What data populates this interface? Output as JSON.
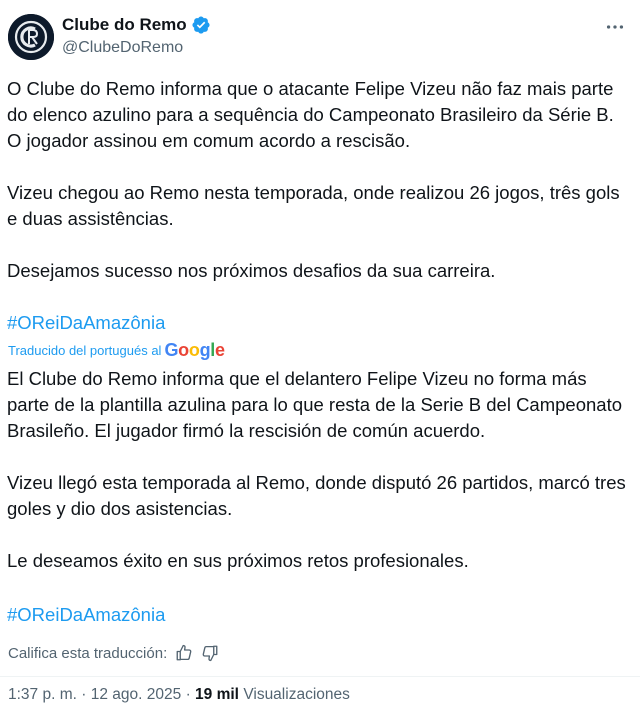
{
  "header": {
    "display_name": "Clube do Remo",
    "handle": "@ClubeDoRemo",
    "verified_icon": "verified-badge-icon",
    "more_icon": "more-options-icon"
  },
  "original": {
    "paragraph1": "O Clube do Remo informa que o atacante Felipe Vizeu não faz mais parte do elenco azulino para a sequência do Campeonato Brasileiro da Série B. O jogador assinou em comum acordo a rescisão.",
    "paragraph2": "Vizeu chegou ao Remo nesta temporada, onde realizou 26 jogos, três gols e duas assistências.",
    "paragraph3": "Desejamos sucesso nos próximos desafios da sua carreira.",
    "hashtag": "#OReiDaAmazônia"
  },
  "translation_note": {
    "label": "Traducido del portugués al",
    "brand": "Google"
  },
  "translated": {
    "paragraph1": "El Clube do Remo informa que el delantero Felipe Vizeu no forma más parte de la plantilla azulina para lo que resta de la Serie B del Campeonato Brasileño. El jugador firmó la rescisión de común acuerdo.",
    "paragraph2": "Vizeu llegó esta temporada al Remo, donde disputó 26 partidos, marcó tres goles y dio dos asistencias.",
    "paragraph3": "Le deseamos éxito en sus próximos retos profesionales.",
    "hashtag": "#OReiDaAmazônia"
  },
  "rating": {
    "label": "Califica esta traducción:",
    "like_icon": "thumbs-up-icon",
    "dislike_icon": "thumbs-down-icon"
  },
  "meta": {
    "time": "1:37 p. m.",
    "separator": "·",
    "date": "12 ago. 2025",
    "views_count": "19 mil",
    "views_label": "Visualizaciones"
  },
  "colors": {
    "accent": "#1d9bf0",
    "text": "#0f1419",
    "muted": "#536471"
  }
}
